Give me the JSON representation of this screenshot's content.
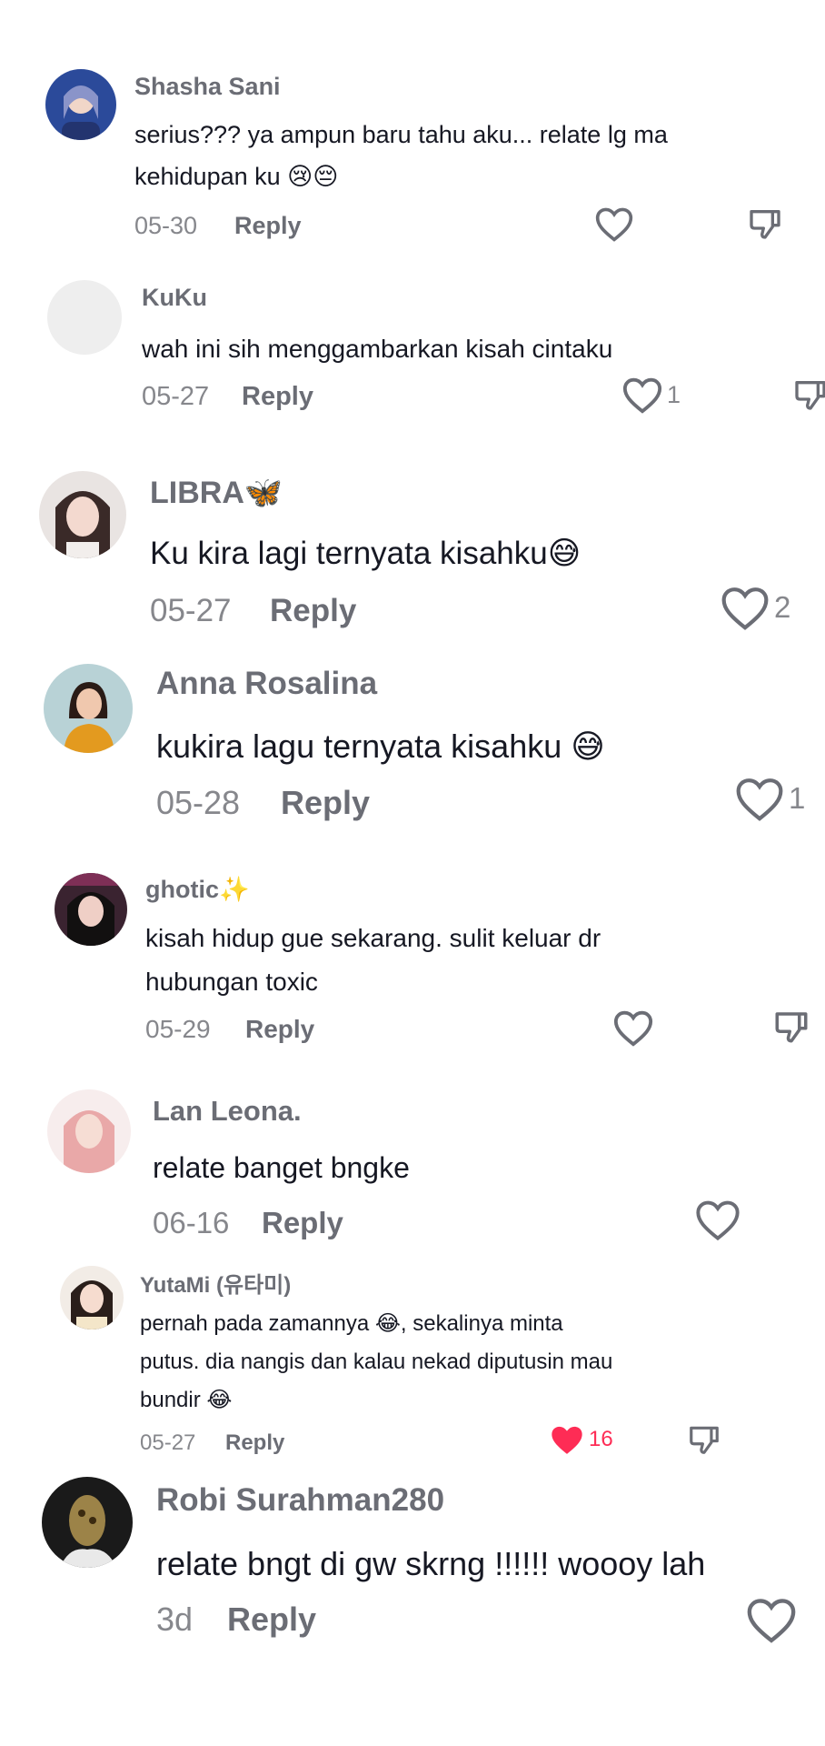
{
  "comments": [
    {
      "username": "Shasha Sani",
      "text_lines": [
        "serius??? ya ampun baru tahu aku... relate lg ma",
        "kehidupan ku 😢😔"
      ],
      "date": "05-30",
      "reply": "Reply",
      "likes": "",
      "avatar_color": "#3b5bb5"
    },
    {
      "username": "KuKu",
      "text_lines": [
        "wah ini sih menggambarkan kisah cintaku"
      ],
      "date": "05-27",
      "reply": "Reply",
      "likes": "1",
      "avatar_color": "#eeeeee"
    },
    {
      "username": "LIBRA🦋",
      "text_lines": [
        "Ku kira lagi ternyata kisahku😅"
      ],
      "date": "05-27",
      "reply": "Reply",
      "likes": "2",
      "avatar_color": "#c9a99a"
    },
    {
      "username": "Anna Rosalina",
      "text_lines": [
        "kukira lagu ternyata kisahku 😅"
      ],
      "date": "05-28",
      "reply": "Reply",
      "likes": "1",
      "avatar_color": "#d99a2a"
    },
    {
      "username": "ghotic✨",
      "text_lines": [
        "kisah hidup gue sekarang. sulit keluar dr",
        "hubungan toxic"
      ],
      "date": "05-29",
      "reply": "Reply",
      "likes": "",
      "avatar_color": "#6b3a4a"
    },
    {
      "username": "Lan Leona.",
      "text_lines": [
        "relate banget bngke"
      ],
      "date": "06-16",
      "reply": "Reply",
      "likes": "",
      "avatar_color": "#e8b4b8"
    },
    {
      "username": "YutaMi (유타미)",
      "text_lines": [
        "pernah pada zamannya 😂, sekalinya minta",
        "putus. dia nangis dan kalau nekad diputusin mau",
        "bundir 😂"
      ],
      "date": "05-27",
      "reply": "Reply",
      "likes": "16",
      "liked": true,
      "avatar_color": "#d8c7b8"
    },
    {
      "username": "Robi Surahman280",
      "text_lines": [
        "relate bngt di gw skrng !!!!!! woooy lah"
      ],
      "date": "3d",
      "reply": "Reply",
      "likes": "",
      "avatar_color": "#6a5a3a"
    }
  ],
  "colors": {
    "like_red": "#fe2c55",
    "icon_gray": "#6b6d75"
  },
  "icons": {
    "like": "heart-outline-icon",
    "liked": "heart-filled-icon",
    "dislike": "thumbs-down-icon"
  }
}
